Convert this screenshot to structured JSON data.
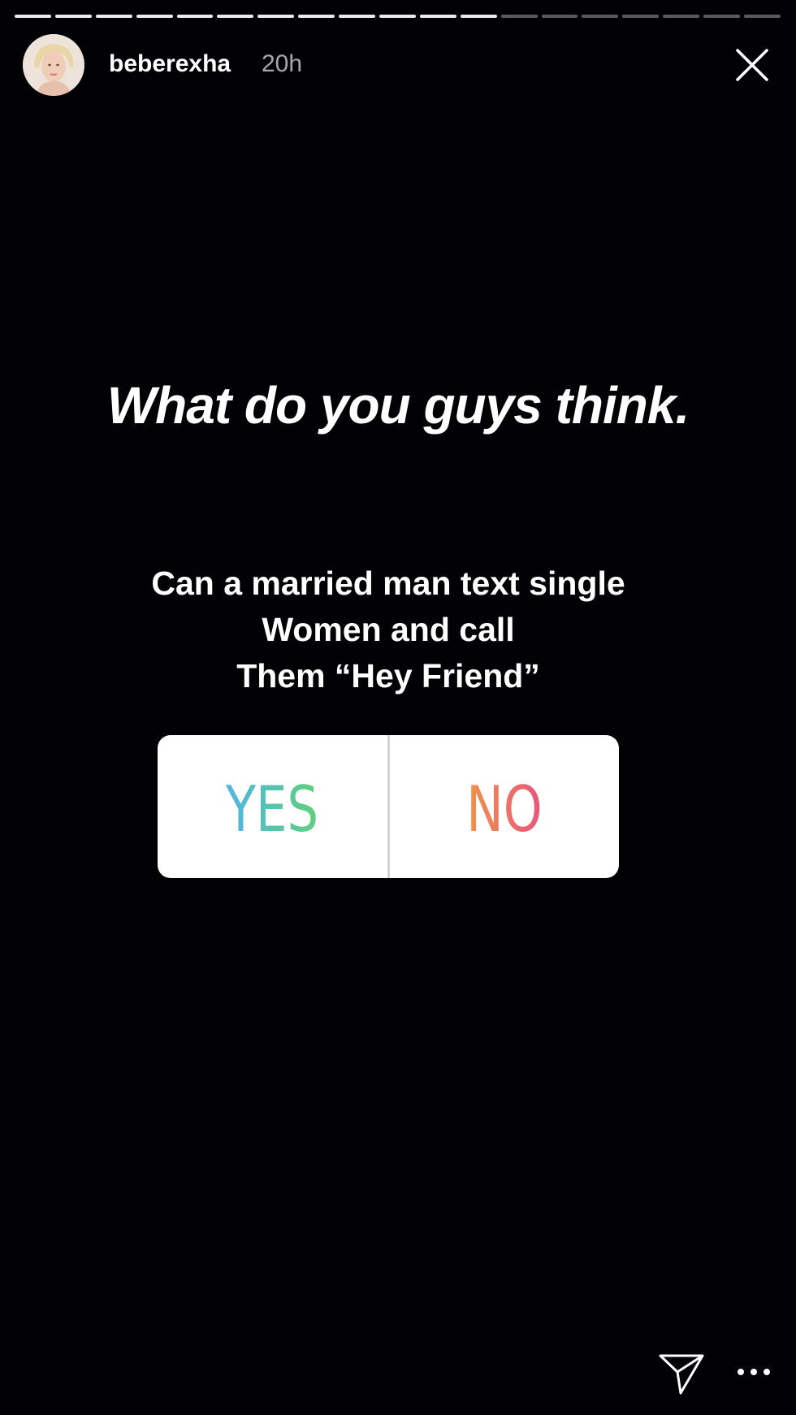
{
  "progress": {
    "total_segments": 19,
    "completed_segments": 12
  },
  "header": {
    "username": "beberexha",
    "time": "20h"
  },
  "story": {
    "headline": "What do you guys think.",
    "question_lines": [
      "Can a married man text single",
      "Women and call",
      "Them “Hey Friend”"
    ]
  },
  "poll": {
    "options": [
      {
        "label": "YES",
        "gradient": [
          "#4fb6e6",
          "#61d07a"
        ]
      },
      {
        "label": "NO",
        "gradient": [
          "#f0944a",
          "#e8557e"
        ]
      }
    ]
  },
  "icons": {
    "close": "close-icon",
    "send": "paper-plane-icon",
    "more": "more-dots-icon"
  }
}
